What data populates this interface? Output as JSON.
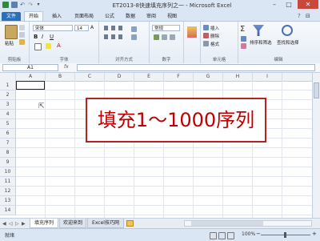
{
  "window": {
    "title": "ET2013-8快速填充序列之一 - Microsoft Excel",
    "minimize": "–",
    "maximize": "□",
    "close": "✕"
  },
  "tabs": [
    "文件",
    "开始",
    "插入",
    "页面布局",
    "公式",
    "数据",
    "审阅",
    "视图"
  ],
  "ribbon": {
    "paste_label": "粘贴",
    "font_name": "宋体",
    "font_size": "14",
    "bold": "B",
    "italic": "I",
    "underline": "U",
    "number_format": "常规",
    "insert_label": "插入",
    "delete_label": "删除",
    "format_label": "格式",
    "sort_filter_label": "排序和筛选",
    "find_select_label": "查找和选择",
    "groups": {
      "clipboard": "剪贴板",
      "font": "字体",
      "alignment": "对齐方式",
      "number": "数字",
      "cells": "单元格",
      "editing": "编辑"
    }
  },
  "formula_bar": {
    "cell_ref": "A1",
    "fx_label": "fx",
    "value": ""
  },
  "grid": {
    "columns": [
      "A",
      "B",
      "C",
      "D",
      "E",
      "F",
      "G",
      "H",
      "I"
    ],
    "rows": [
      "1",
      "2",
      "3",
      "4",
      "5",
      "6",
      "7",
      "8",
      "9",
      "10",
      "11",
      "12",
      "13",
      "14"
    ]
  },
  "overlay_text": "填充1～1000序列",
  "sheets": [
    "填充序列",
    "欢迎来到",
    "Excel技巧网"
  ],
  "status": {
    "ready": "就绪",
    "zoom": "100%"
  },
  "colors": {
    "accent": "#2a6fb8",
    "overlay_border": "#b52222",
    "overlay_text": "#c00000"
  }
}
